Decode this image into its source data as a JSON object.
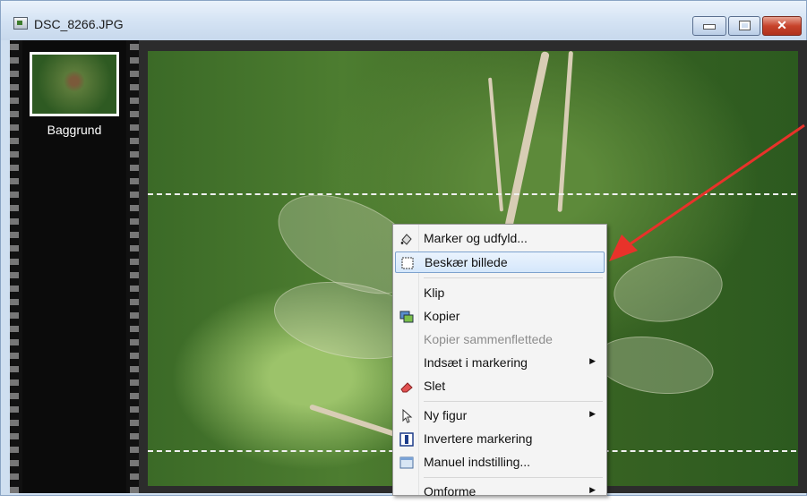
{
  "window": {
    "title": "DSC_8266.JPG",
    "min_icon": "minimize-icon",
    "max_icon": "maximize-icon",
    "close_symbol": "✕"
  },
  "filmstrip": {
    "thumbnail_label": "Baggrund"
  },
  "context_menu": {
    "items": [
      {
        "label": "Marker og udfyld...",
        "icon": "fill-select-icon"
      },
      {
        "label": "Beskær billede",
        "icon": "crop-icon",
        "highlighted": true
      },
      {
        "label": "Klip"
      },
      {
        "label": "Kopier",
        "icon": "copy-icon"
      },
      {
        "label": "Kopier sammenflettede",
        "disabled": true
      },
      {
        "label": "Indsæt i markering",
        "submenu": true
      },
      {
        "label": "Slet",
        "icon": "eraser-icon"
      },
      {
        "label": "Ny figur",
        "icon": "cursor-icon",
        "submenu": true
      },
      {
        "label": "Invertere markering",
        "icon": "invert-icon"
      },
      {
        "label": "Manuel indstilling...",
        "icon": "settings-icon"
      },
      {
        "label": "Omforme",
        "submenu": true
      }
    ],
    "submenu_arrow": "▶"
  },
  "annotation": {
    "arrow_color": "#e8322a"
  }
}
